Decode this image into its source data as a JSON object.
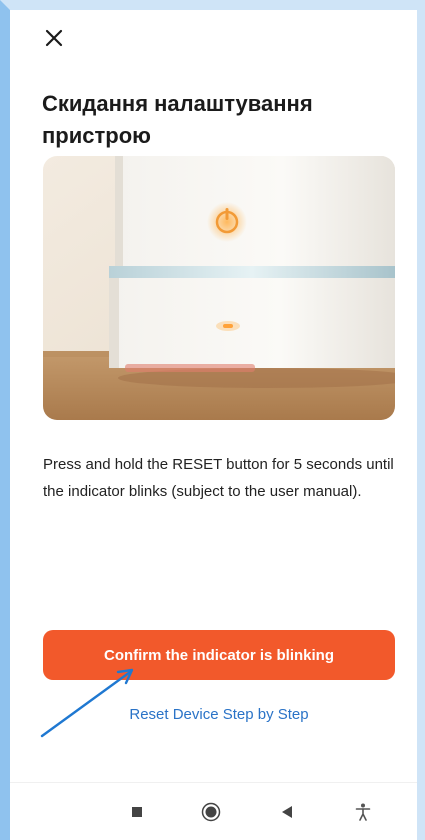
{
  "header": {
    "close_icon": "close-icon"
  },
  "page": {
    "title": "Скидання налаштування пристрою",
    "image_alt": "device-photo",
    "description": "Press and hold the RESET button for 5 seconds until the indicator blinks (subject to the user manual)."
  },
  "actions": {
    "confirm_label": "Confirm the indicator is blinking",
    "reset_link_label": "Reset Device Step by Step"
  },
  "nav": {
    "items": [
      "recents-icon",
      "home-icon",
      "back-icon",
      "accessibility-icon"
    ]
  },
  "colors": {
    "accent": "#f2592b",
    "link": "#2a73c7",
    "frame": "#8fc2ee",
    "annotation_arrow": "#1f78d1"
  }
}
